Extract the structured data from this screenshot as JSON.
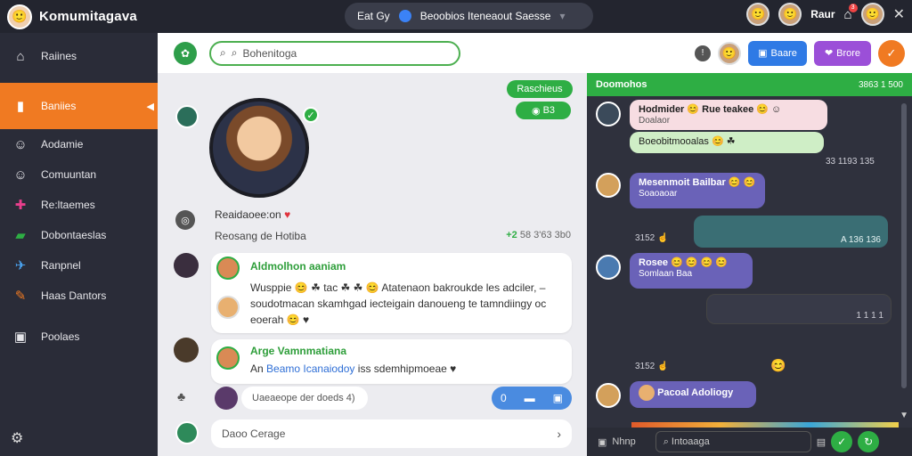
{
  "app": {
    "title": "Komumitagava",
    "center_tab_a": "Eat Gy",
    "center_tab_b": "Beoobios Iteneaout Saesse",
    "user_name": "Raur",
    "notif_count": "3"
  },
  "sidebar": {
    "items": [
      {
        "label": "Raiines",
        "icon": "home-icon"
      },
      {
        "label": "Baniies",
        "icon": "book-icon"
      },
      {
        "label": "Aodamie",
        "icon": "avatar-icon"
      },
      {
        "label": "Comuuntan",
        "icon": "avatar-icon"
      },
      {
        "label": "Re:ltaemes",
        "icon": "plus-icon"
      },
      {
        "label": "Dobontaeslas",
        "icon": "money-icon"
      },
      {
        "label": "Ranpnel",
        "icon": "plane-icon"
      },
      {
        "label": "Haas Dantors",
        "icon": "pencil-icon"
      },
      {
        "label": "Poolaes",
        "icon": "camera-icon"
      }
    ]
  },
  "center": {
    "search_placeholder": "Bohenitoga",
    "pill_top": "Raschieus",
    "pill_second": "B3",
    "profile_name": "Reaidaoee:on",
    "profile_sub": "Reosang de Hotiba",
    "profile_stat_plus": "+2",
    "profile_stat": "58 3'63 3b0",
    "post1": {
      "author": "Aldmolhon aaniam",
      "line1": "Wusppie",
      "line1b": "tac",
      "line1c": "Atatenaon bakroukde les adciler, –",
      "line2": "soudotmacan skamhgad iecteigain danoueng te tamndiingy oc",
      "line3": "eoerah"
    },
    "post2": {
      "author": "Arge Vamnmatiana",
      "text_pre": "An",
      "link": "Beamo Icanaiodoy",
      "text_post": "iss sdemhipmoeae"
    },
    "reply_placeholder": "Uaeaeope der doeds 4)",
    "blue_pill_left": "0",
    "composer_placeholder": "Daoo Cerage"
  },
  "chat": {
    "btn_blue": "Baare",
    "btn_purple": "Brore",
    "header_title": "Doomohos",
    "header_time": "3863 1 500",
    "messages": [
      {
        "text": "Hodmider",
        "text2": "Rue teakee",
        "sub": "Doalaor"
      },
      {
        "text": "Boeobitmooalas"
      },
      {
        "time": "33 1193 135"
      },
      {
        "text": "Mesenmoit Bailbar",
        "sub": "Soaoaoar"
      },
      {
        "time_left": "3152"
      },
      {
        "time": "A 136 136"
      },
      {
        "text": "Rosee",
        "sub": "Somlaan Baa"
      },
      {
        "time": "1 1 1 1"
      },
      {
        "time_left": "3152"
      },
      {
        "text": "Pacoal Adoliogy"
      }
    ],
    "input_label": "Nhnp",
    "input_placeholder": "Intoaaga"
  },
  "colors": {
    "accent_orange": "#f07a22",
    "accent_green": "#2eae44",
    "accent_blue": "#2f7ae5",
    "accent_purple": "#9b4fd8"
  }
}
